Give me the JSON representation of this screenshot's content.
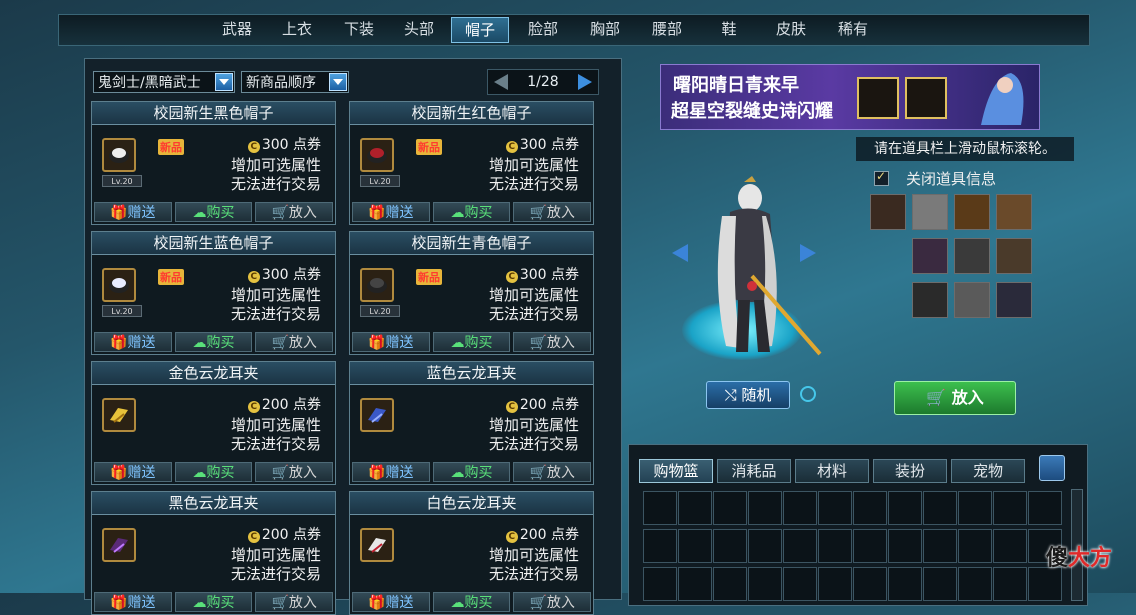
{
  "top_tabs": [
    "武器",
    "上衣",
    "下装",
    "头部",
    "帽子",
    "脸部",
    "胸部",
    "腰部",
    "鞋",
    "皮肤",
    "稀有"
  ],
  "active_tab_index": 4,
  "filters": {
    "character": "鬼剑士/黑暗武士",
    "sort": "新商品顺序"
  },
  "pager": {
    "text": "1/28"
  },
  "cards": [
    {
      "title": "校园新生黑色帽子",
      "new": "新品",
      "price": "300 点券",
      "line1": "增加可选属性",
      "line2": "无法进行交易",
      "level": "Lv.20",
      "icon": "black-cap-icon"
    },
    {
      "title": "校园新生红色帽子",
      "new": "新品",
      "price": "300 点券",
      "line1": "增加可选属性",
      "line2": "无法进行交易",
      "level": "Lv.20",
      "icon": "red-cap-icon"
    },
    {
      "title": "校园新生蓝色帽子",
      "new": "新品",
      "price": "300 点券",
      "line1": "增加可选属性",
      "line2": "无法进行交易",
      "level": "Lv.20",
      "icon": "blue-cap-icon"
    },
    {
      "title": "校园新生青色帽子",
      "new": "新品",
      "price": "300 点券",
      "line1": "增加可选属性",
      "line2": "无法进行交易",
      "level": "Lv.20",
      "icon": "cyan-cap-icon"
    },
    {
      "title": "金色云龙耳夹",
      "new": "",
      "price": "200 点券",
      "line1": "增加可选属性",
      "line2": "无法进行交易",
      "level": "",
      "icon": "gold-earclip-icon"
    },
    {
      "title": "蓝色云龙耳夹",
      "new": "",
      "price": "200 点券",
      "line1": "增加可选属性",
      "line2": "无法进行交易",
      "level": "",
      "icon": "blue-earclip-icon"
    },
    {
      "title": "黑色云龙耳夹",
      "new": "",
      "price": "200 点券",
      "line1": "增加可选属性",
      "line2": "无法进行交易",
      "level": "",
      "icon": "black-earclip-icon"
    },
    {
      "title": "白色云龙耳夹",
      "new": "",
      "price": "200 点券",
      "line1": "增加可选属性",
      "line2": "无法进行交易",
      "level": "",
      "icon": "white-earclip-icon"
    }
  ],
  "card_buttons": {
    "gift": "赠送",
    "buy": "购买",
    "put": "放入"
  },
  "banner": {
    "line1": "曙阳晴日青来早",
    "line2": "超星空裂缝史诗闪耀"
  },
  "tip": "请在道具栏上滑动鼠标滚轮。",
  "close_item_info": "关闭道具信息",
  "random_button": "随机",
  "put_button": "放入",
  "cart_tabs": [
    "购物篮",
    "消耗品",
    "材料",
    "装扮",
    "宠物"
  ],
  "watermark": {
    "a": "傻",
    "b": "大方"
  },
  "colors": {
    "accent": "#2f6f92",
    "buy_green": "#59e07a",
    "gift_blue": "#7fc4ff"
  }
}
